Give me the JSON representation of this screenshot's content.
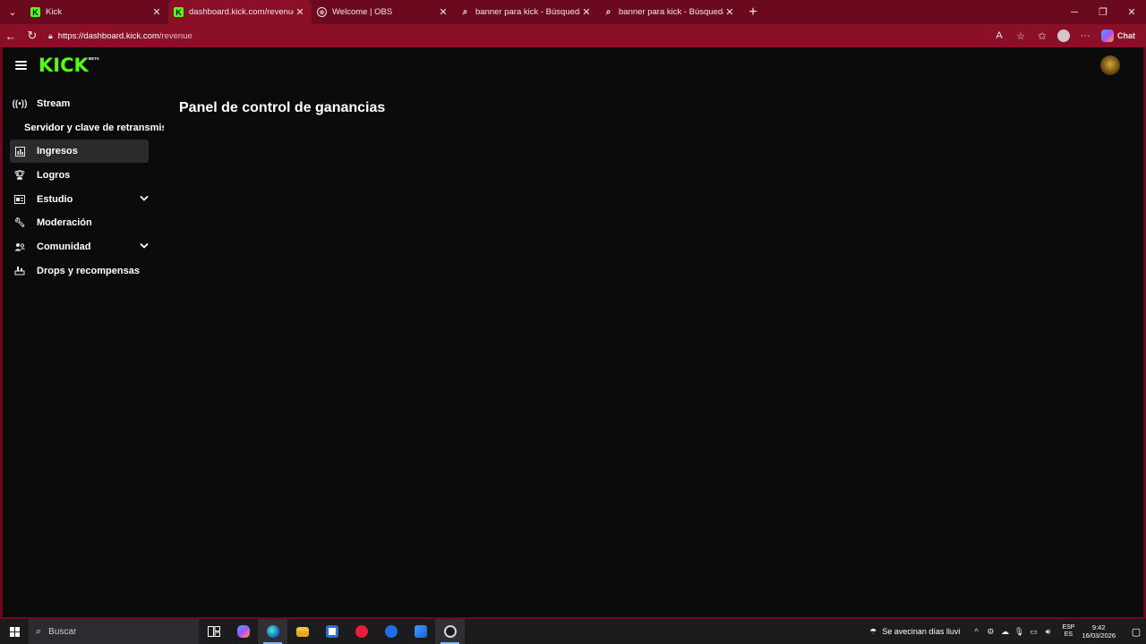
{
  "browser": {
    "tabs": [
      {
        "title": "Kick",
        "favicon": "kick-icon",
        "active": false
      },
      {
        "title": "dashboard.kick.com/revenue",
        "favicon": "kick-icon",
        "active": true
      },
      {
        "title": "Welcome | OBS",
        "favicon": "globe-icon",
        "active": false
      },
      {
        "title": "banner para kick - Búsqueda",
        "favicon": "search-icon",
        "active": false
      },
      {
        "title": "banner para kick - Búsqueda imág",
        "favicon": "search-icon",
        "active": false
      }
    ],
    "url_host": "https://dashboard.kick.com",
    "url_path": "/revenue",
    "chat_label": "Chat"
  },
  "app": {
    "logo_text": "KICK",
    "beta_label": "BETA",
    "page_title": "Panel de control de ganancias"
  },
  "sidebar": {
    "items": [
      {
        "label": "Stream",
        "icon": "broadcast-icon",
        "active": false,
        "expandable": false
      },
      {
        "label": "Servidor y clave de retransmisión",
        "icon": "",
        "active": false,
        "expandable": false,
        "sub": true
      },
      {
        "label": "Ingresos",
        "icon": "chart-icon",
        "active": true,
        "expandable": false
      },
      {
        "label": "Logros",
        "icon": "trophy-icon",
        "active": false,
        "expandable": false
      },
      {
        "label": "Estudio",
        "icon": "studio-icon",
        "active": false,
        "expandable": true
      },
      {
        "label": "Moderación",
        "icon": "wrench-icon",
        "active": false,
        "expandable": false
      },
      {
        "label": "Comunidad",
        "icon": "community-icon",
        "active": false,
        "expandable": true
      },
      {
        "label": "Drops y recompensas",
        "icon": "drops-icon",
        "active": false,
        "expandable": false
      }
    ]
  },
  "taskbar": {
    "search_placeholder": "Buscar",
    "weather_text": "Se avecinan días lluvi",
    "lang_top": "ESP",
    "lang_bottom": "ES",
    "time": "9:42",
    "date": "16/03/2026"
  },
  "colors": {
    "browser_frame": "#6b0a1e",
    "active_tab": "#8a0f27",
    "kick_green": "#53fc18",
    "page_bg": "#0b0b0c",
    "active_nav": "#2a2b2d"
  }
}
